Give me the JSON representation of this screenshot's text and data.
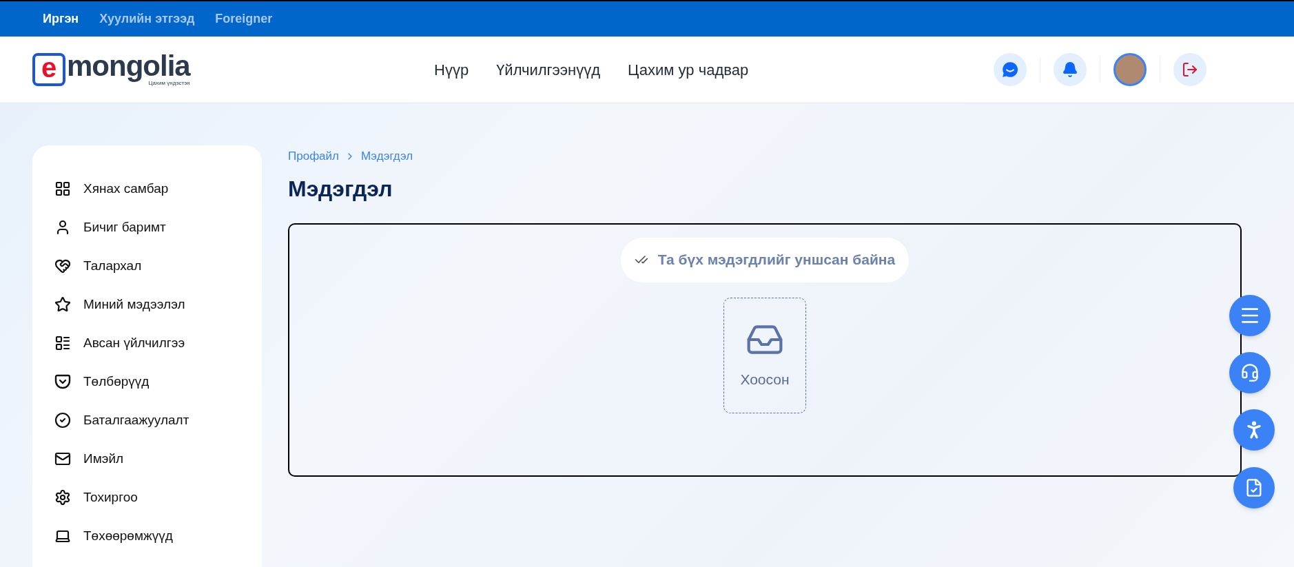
{
  "top_tabs": [
    {
      "label": "Иргэн",
      "selected": true
    },
    {
      "label": "Хуулийн этгээд",
      "selected": false
    },
    {
      "label": "Foreigner",
      "selected": false
    }
  ],
  "logo": {
    "letter": "e",
    "name": "mongolia",
    "tagline": "Цахим үндэстэн"
  },
  "nav": [
    "Нүүр",
    "Үйлчилгээнүүд",
    "Цахим ур чадвар"
  ],
  "sidebar": {
    "items": [
      {
        "label": "Хянах самбар",
        "kind": "grid"
      },
      {
        "label": "Бичиг баримт",
        "kind": "user"
      },
      {
        "label": "Талархал",
        "kind": "heart"
      },
      {
        "label": "Миний мэдээлэл",
        "kind": "star"
      },
      {
        "label": "Авсан үйлчилгээ",
        "kind": "list"
      },
      {
        "label": "Төлбөрүүд",
        "kind": "pocket"
      },
      {
        "label": "Баталгаажуулалт",
        "kind": "check"
      },
      {
        "label": "Имэйл",
        "kind": "mail"
      },
      {
        "label": "Тохиргоо",
        "kind": "settings"
      },
      {
        "label": "Төхөөрөмжүүд",
        "kind": "laptop"
      }
    ]
  },
  "breadcrumb": [
    "Профайл",
    "Мэдэгдэл"
  ],
  "title": "Мэдэгдэл",
  "notice": "Та бүх мэдэгдлийг уншсан байна",
  "empty_label": "Хоосон"
}
